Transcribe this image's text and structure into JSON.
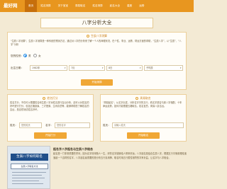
{
  "header": {
    "logo": "最好网",
    "nav": [
      "首页",
      "姓名测算",
      "关于宝宝",
      "周易取名",
      "姓名测算",
      "起名大全",
      "星座",
      "运势"
    ]
  },
  "page_title": "八字分析大全",
  "bazi": {
    "heading": "生辰八字测算",
    "intro": "\"生辰八字测算\"，生辰八字测算是一种传统的预测方法，通过对八字的分析来了解一个人的命理状况，在个性、事业、运势、财运方面的帮助，“生辰八字”，以“生辰”、“八字”分析",
    "gender_label": "您的性别：",
    "gender_options": [
      "男",
      "女"
    ],
    "date_label": "出生日期：",
    "year": "1982年",
    "month": "7月",
    "day": "8日",
    "hour": "子时辰",
    "button": "开始测算"
  },
  "left_card": {
    "heading": "姓名打分",
    "intro": "姓名打分，不仅可以根据姓名和生辰八字对姓名进行吉凶分析，还可以对姓名的好坏进行打分，包括五格剖象、三才配置、生肖喜忌等，能够帮助您了解姓名的吉凶，是自然测试姓名好坏。",
    "surname_label": "姓氏：",
    "surname_placeholder": "您的姓氏",
    "name_label": "名字：",
    "name_placeholder": "您的名字",
    "button": "开始打分"
  },
  "right_card": {
    "heading": "周易取名",
    "intro": "\"周易起名\"，从名字出发，分析名字中的五行，看名字是否与其八字相配，十年命运走势，如何才能根据五格取名，姓名宜忌，周易八卦吉凶。",
    "surname_label": "姓氏：",
    "surname_placeholder": "请输入姓氏",
    "button": "开始取名"
  },
  "article": {
    "image_title": "生辰八字如何取名",
    "image_sub": "生辰八字取名方法",
    "title": "起名字八字起名与生辰八字结合",
    "text": "起名是一门非常重要的学问，因为名字将伴随人一生，好的名字能够给人带来好运。八字起名是结合生辰八字，根据五行平衡原理给宝宝起一个吉祥的名字，八字起名最重要的是分析五行喜用神，取名时用五行属性相符的字来补益，让名字与八字相合。"
  },
  "colors": {
    "topbar": "#e8961f",
    "accent": "#f0a735",
    "background": "#f3ead4"
  }
}
